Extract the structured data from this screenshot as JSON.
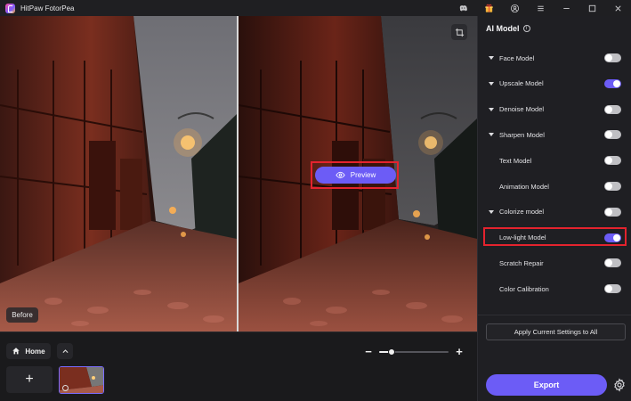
{
  "app": {
    "title": "HitPaw FotorPea"
  },
  "titlebar": {
    "icons": [
      "discord-icon",
      "gift-icon",
      "account-icon",
      "menu-icon",
      "minimize-icon",
      "maximize-icon",
      "close-icon"
    ]
  },
  "canvas": {
    "before_label": "Before",
    "preview_label": "Preview"
  },
  "bottom": {
    "home_label": "Home",
    "add_label": "+",
    "zoom_minus": "−",
    "zoom_plus": "+",
    "zoom_level": 0.18
  },
  "panel": {
    "title": "AI Model",
    "info_glyph": "i",
    "models": [
      {
        "label": "Face Model",
        "expandable": true,
        "enabled": false
      },
      {
        "label": "Upscale Model",
        "expandable": true,
        "enabled": true
      },
      {
        "label": "Denoise Model",
        "expandable": true,
        "enabled": false
      },
      {
        "label": "Sharpen Model",
        "expandable": true,
        "enabled": false
      },
      {
        "label": "Text Model",
        "expandable": false,
        "enabled": false
      },
      {
        "label": "Animation Model",
        "expandable": false,
        "enabled": false
      },
      {
        "label": "Colorize model",
        "expandable": true,
        "enabled": false
      },
      {
        "label": "Low-light Model",
        "expandable": false,
        "enabled": true
      },
      {
        "label": "Scratch Repair",
        "expandable": false,
        "enabled": false
      },
      {
        "label": "Color Calibration",
        "expandable": false,
        "enabled": false
      }
    ],
    "apply_label": "Apply Current Settings to All",
    "export_label": "Export"
  },
  "colors": {
    "accent": "#6c5cf6",
    "highlight": "#e4232e",
    "panel_bg": "#1f1f23"
  }
}
